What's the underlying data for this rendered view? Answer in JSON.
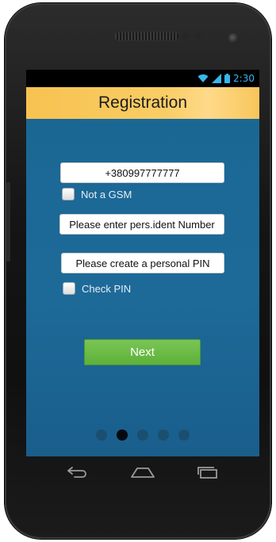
{
  "status_bar": {
    "time": "2:30"
  },
  "header": {
    "title": "Registration"
  },
  "form": {
    "phone_value": "+380997777777",
    "not_gsm_label": "Not a GSM",
    "not_gsm_checked": false,
    "ident_placeholder": "Please enter pers.ident Number",
    "pin_placeholder": "Please create a personal PIN",
    "check_pin_label": "Check PIN",
    "check_pin_checked": false,
    "next_label": "Next"
  },
  "pager": {
    "total": 5,
    "active_index": 1
  },
  "colors": {
    "header_bg": "#f7c250",
    "content_bg": "#1b6794",
    "button_green": "#6ab946",
    "status_accent": "#37b6ec"
  },
  "icons": {
    "status": [
      "wifi-icon",
      "signal-icon",
      "battery-icon"
    ],
    "nav": [
      "back-icon",
      "home-icon",
      "recent-apps-icon"
    ]
  }
}
